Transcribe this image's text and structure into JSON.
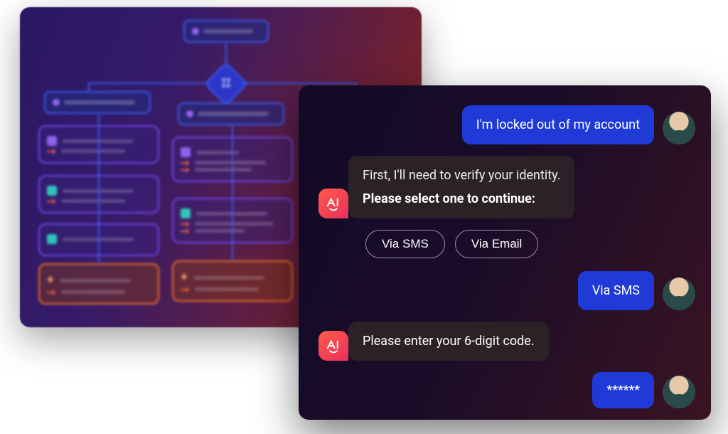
{
  "chat": {
    "user_msg_1": "I'm locked out of my account",
    "bot_msg_1_line1": "First, I'll need to verify your identity.",
    "bot_msg_1_line2": "Please select one to continue:",
    "option_sms": "Via SMS",
    "option_email": "Via Email",
    "user_msg_2": "Via SMS",
    "bot_msg_2": "Please enter your 6-digit code.",
    "user_msg_3": "******"
  },
  "icons": {
    "ai_badge": "ai-logo",
    "user_avatar": "user-avatar"
  }
}
